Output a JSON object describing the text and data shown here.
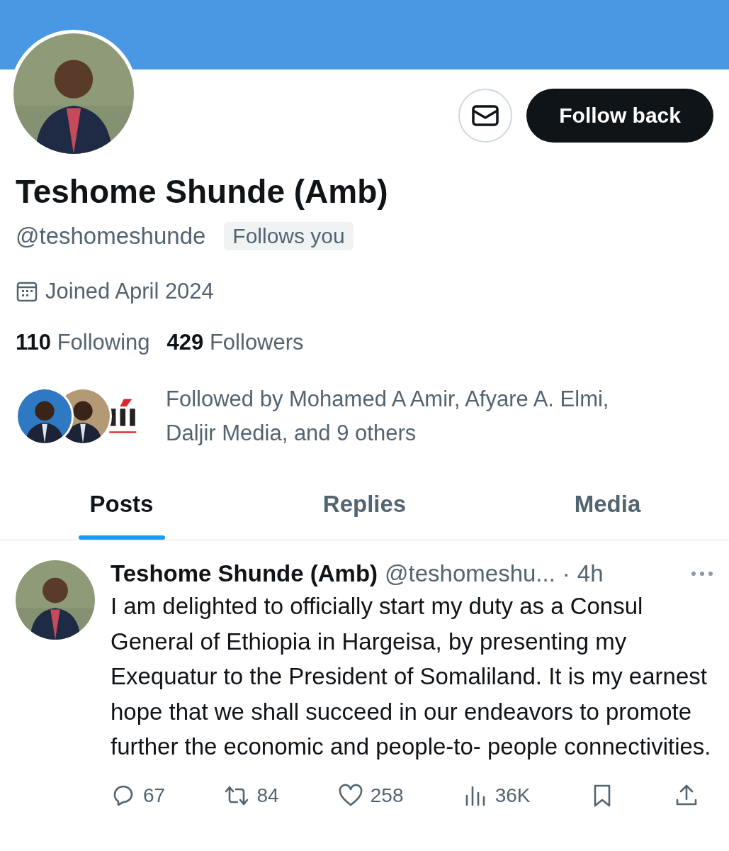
{
  "profile": {
    "name": "Teshome Shunde (Amb)",
    "handle": "@teshomeshunde",
    "follows_you": "Follows you",
    "joined": "Joined April 2024",
    "stats": [
      {
        "count": "110",
        "label": "Following"
      },
      {
        "count": "429",
        "label": "Followers"
      }
    ],
    "followed_by": "Followed by Mohamed A Amir, Afyare A. Elmi, Daljir Media, and 9 others",
    "mutuals": [
      {
        "kind": "person"
      },
      {
        "kind": "person"
      },
      {
        "kind": "logo"
      }
    ]
  },
  "actions": {
    "follow_button": "Follow back"
  },
  "tabs": [
    {
      "label": "Posts",
      "selected": true
    },
    {
      "label": "Replies",
      "selected": false
    },
    {
      "label": "Media",
      "selected": false
    }
  ],
  "post": {
    "name": "Teshome Shunde (Amb)",
    "handle": "@teshomeshu...",
    "separator": "·",
    "time": "4h",
    "text": "I am delighted to officially start my duty as a Consul General of Ethiopia in Hargeisa, by presenting my Exequatur to the President of Somaliland. It is my earnest hope that we shall succeed in our endeavors to promote further the economic and people-to- people connectivities.",
    "actions": [
      {
        "kind": "reply",
        "count": "67"
      },
      {
        "kind": "repost",
        "count": "84"
      },
      {
        "kind": "like",
        "count": "258"
      },
      {
        "kind": "views",
        "count": "36K"
      },
      {
        "kind": "bookmark"
      },
      {
        "kind": "share"
      }
    ]
  }
}
